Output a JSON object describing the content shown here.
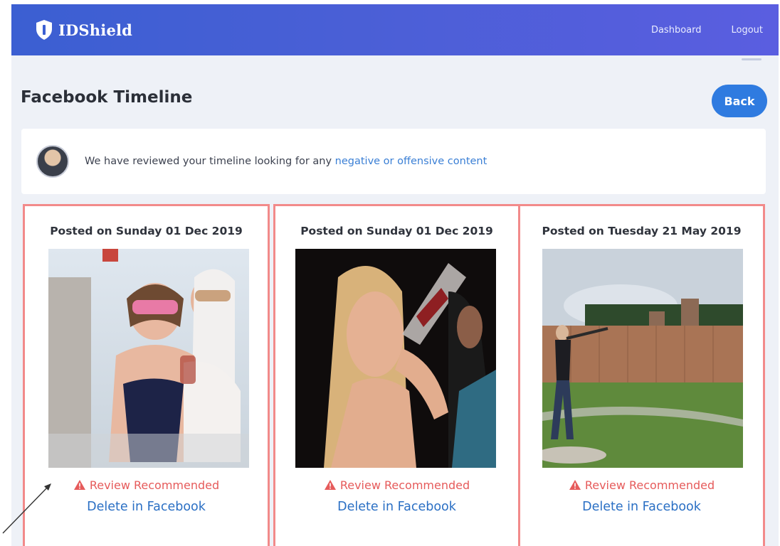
{
  "navbar": {
    "brand": "IDShield",
    "links": [
      {
        "label": "Dashboard"
      },
      {
        "label": "Logout"
      }
    ]
  },
  "page": {
    "title": "Facebook Timeline",
    "back_label": "Back"
  },
  "notice": {
    "text": "We have reviewed your timeline looking for any ",
    "link": "negative or offensive content"
  },
  "posts": [
    {
      "date": "Posted on Sunday 01 Dec 2019",
      "status": "Review Recommended",
      "action": "Delete in Facebook"
    },
    {
      "date": "Posted on Sunday 01 Dec 2019",
      "status": "Review Recommended",
      "action": "Delete in Facebook"
    },
    {
      "date": "Posted on Tuesday 21 May 2019",
      "status": "Review Recommended",
      "action": "Delete in Facebook"
    }
  ],
  "colors": {
    "navbar_start": "#3b5fd2",
    "navbar_end": "#5a5ee0",
    "accent": "#2f7be0",
    "warning": "#e65b5b",
    "card_border": "#f28a8a",
    "link": "#2a6fc4"
  },
  "icons": {
    "brand": "shield-icon",
    "status": "warning-triangle-icon"
  }
}
